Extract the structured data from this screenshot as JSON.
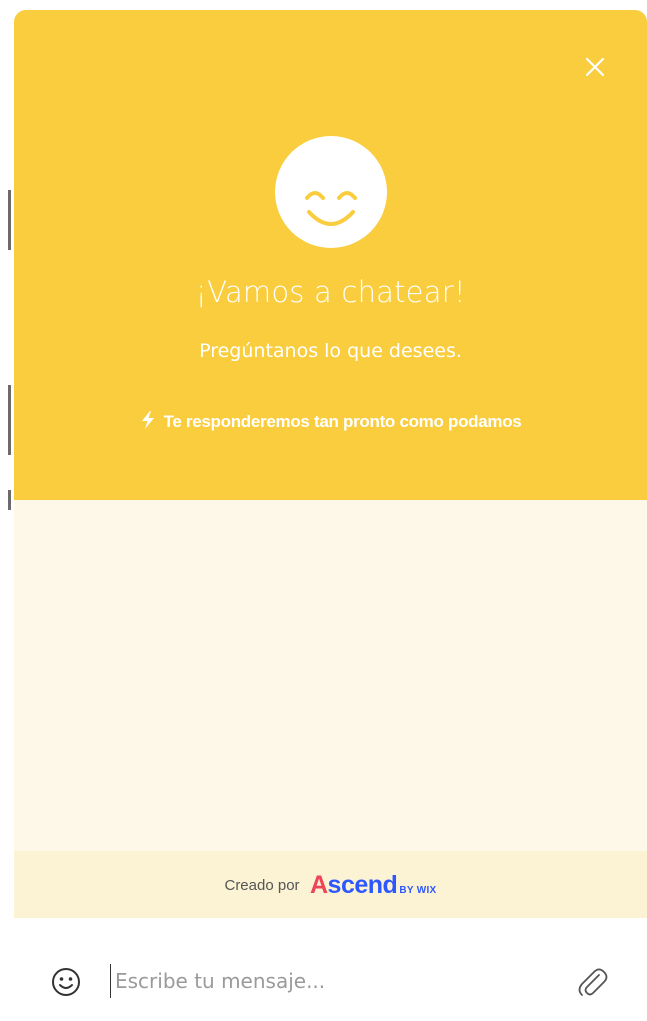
{
  "colors": {
    "header_bg": "#f9cd3d",
    "chat_bg": "#fef8e9",
    "credit_bg": "#fcf2d4",
    "brand_red": "#ee4359",
    "brand_blue": "#2e58ff"
  },
  "header": {
    "close_icon": "close-icon",
    "avatar_icon": "smiley-face-icon",
    "title": "¡Vamos a chatear!",
    "subtitle": "Pregúntanos lo que desees.",
    "response_icon": "lightning-bolt-icon",
    "response_note": "Te responderemos tan pronto como podamos"
  },
  "credit": {
    "prefix": "Creado por",
    "brand_first_letter": "A",
    "brand_rest": "scend",
    "brand_suffix": "BY WIX"
  },
  "composer": {
    "emoji_icon": "emoji-icon",
    "placeholder": "Escribe tu mensaje...",
    "value": "",
    "attach_icon": "paperclip-icon"
  }
}
